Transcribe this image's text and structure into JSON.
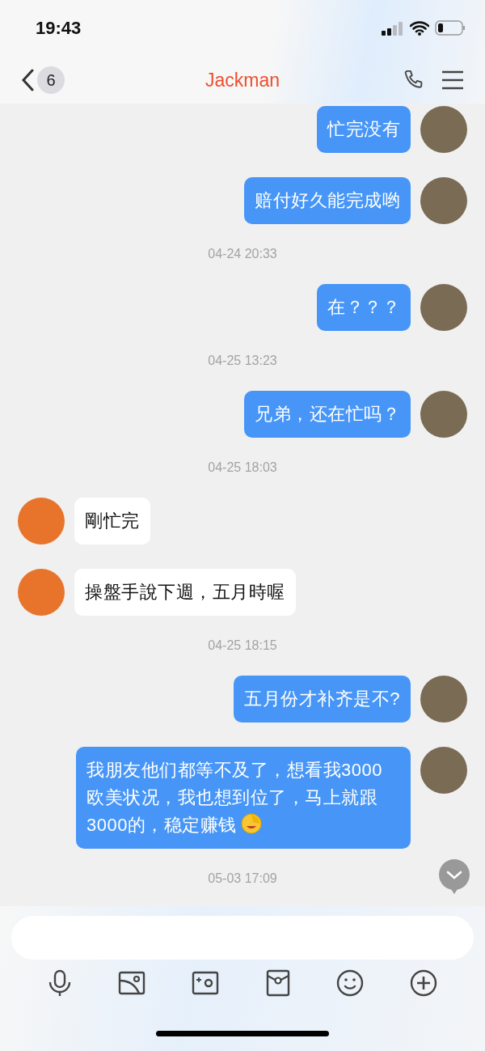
{
  "status_bar": {
    "time": "19:43"
  },
  "header": {
    "back_count": "6",
    "title": "Jackman"
  },
  "messages": [
    {
      "kind": "sent",
      "text": "忙完没有"
    },
    {
      "kind": "sent",
      "text": "赔付好久能完成哟"
    },
    {
      "kind": "time",
      "text": "04-24 20:33"
    },
    {
      "kind": "sent",
      "text": "在？？？"
    },
    {
      "kind": "time",
      "text": "04-25 13:23"
    },
    {
      "kind": "sent",
      "text": "兄弟，还在忙吗？"
    },
    {
      "kind": "time",
      "text": "04-25 18:03"
    },
    {
      "kind": "received",
      "text": "剛忙完"
    },
    {
      "kind": "received",
      "text": "操盤手說下週，五月時喔"
    },
    {
      "kind": "time",
      "text": "04-25 18:15"
    },
    {
      "kind": "sent",
      "text": "五月份才补齐是不?"
    },
    {
      "kind": "sent",
      "text": "我朋友他们都等不及了，想看我3000欧美状况，我也想到位了，马上就跟3000的，稳定赚钱",
      "emoji": true
    },
    {
      "kind": "time",
      "text": "05-03 17:09"
    }
  ]
}
